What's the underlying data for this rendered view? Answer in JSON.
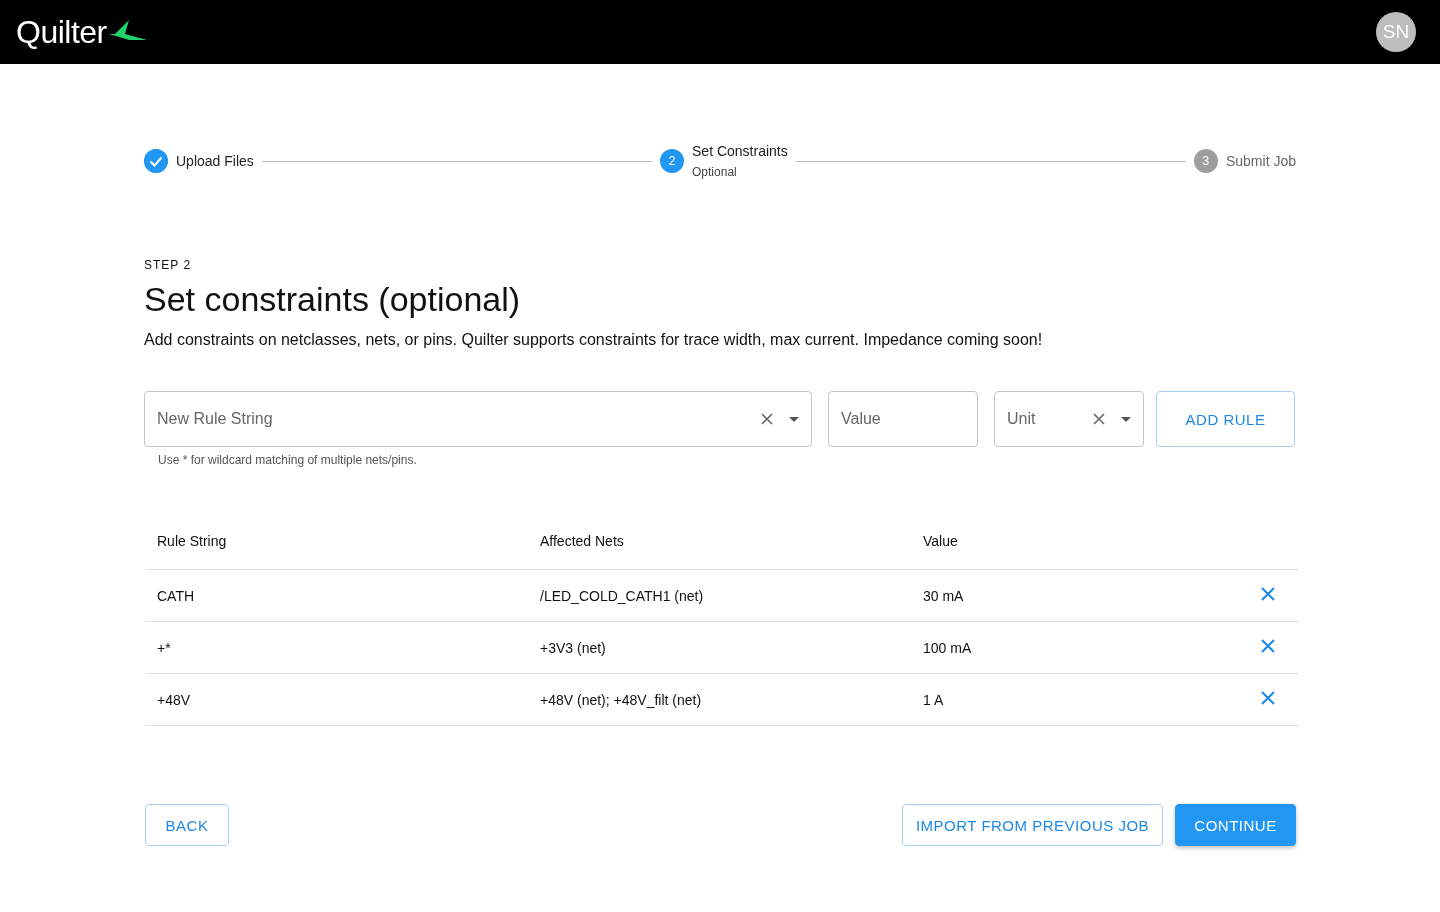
{
  "header": {
    "logo_text": "Quilter",
    "avatar": "SN"
  },
  "stepper": [
    {
      "kind": "done",
      "label": "Upload Files"
    },
    {
      "kind": "active",
      "number": "2",
      "label": "Set Constraints",
      "sublabel": "Optional"
    },
    {
      "kind": "pending",
      "number": "3",
      "label": "Submit Job"
    }
  ],
  "step_label": "STEP 2",
  "title": "Set constraints (optional)",
  "description": "Add constraints on netclasses, nets, or pins. Quilter supports constraints for trace width, max current. Impedance coming soon!",
  "form": {
    "rule_placeholder": "New Rule String",
    "rule_helper": "Use * for wildcard matching of multiple nets/pins.",
    "value_placeholder": "Value",
    "unit_placeholder": "Unit",
    "add_button": "ADD RULE"
  },
  "table": {
    "columns": [
      "Rule String",
      "Affected Nets",
      "Value"
    ],
    "rows": [
      {
        "rule": "CATH",
        "nets": "/LED_COLD_CATH1 (net)",
        "value": "30 mA"
      },
      {
        "rule": "+*",
        "nets": "+3V3 (net)",
        "value": "100 mA"
      },
      {
        "rule": "+48V",
        "nets": "+48V (net); +48V_filt (net)",
        "value": "1 A"
      }
    ]
  },
  "buttons": {
    "back": "BACK",
    "import": "IMPORT FROM PREVIOUS JOB",
    "continue": "CONTINUE"
  }
}
